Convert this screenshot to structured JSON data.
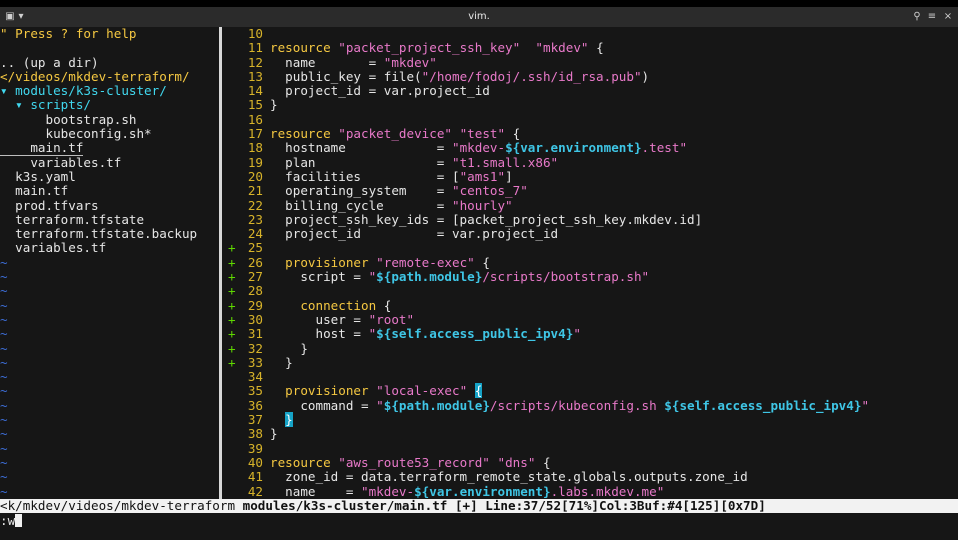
{
  "window": {
    "title": "vim.",
    "left_icons": [
      "terminal-icon",
      "dropdown-icon"
    ],
    "right_icons": [
      "search-icon",
      "menu-icon",
      "close-icon"
    ]
  },
  "tree": [
    {
      "text": "\" Press ? for help",
      "cls": "t-help"
    },
    {
      "text": "",
      "cls": "t-file"
    },
    {
      "text": ".. (up a dir)",
      "cls": "t-file"
    },
    {
      "text": "</videos/mkdev-terraform/",
      "cls": "t-root"
    },
    {
      "text": "▾ modules/k3s-cluster/",
      "cls": "t-dir"
    },
    {
      "text": "  ▾ scripts/",
      "cls": "t-dir"
    },
    {
      "text": "      bootstrap.sh",
      "cls": "t-file"
    },
    {
      "text": "      kubeconfig.sh*",
      "cls": "t-file"
    },
    {
      "text": "    main.tf",
      "cls": "t-file t-sel"
    },
    {
      "text": "    variables.tf",
      "cls": "t-file"
    },
    {
      "text": "  k3s.yaml",
      "cls": "t-file"
    },
    {
      "text": "  main.tf",
      "cls": "t-file"
    },
    {
      "text": "  prod.tfvars",
      "cls": "t-file"
    },
    {
      "text": "  terraform.tfstate",
      "cls": "t-file"
    },
    {
      "text": "  terraform.tfstate.backup",
      "cls": "t-file"
    },
    {
      "text": "  variables.tf",
      "cls": "t-file"
    }
  ],
  "tilde_rows": 17,
  "editor": [
    {
      "n": "10",
      "sign": "",
      "parts": []
    },
    {
      "n": "11",
      "sign": "",
      "parts": [
        [
          "k",
          "resource "
        ],
        [
          "s",
          "\"packet_project_ssh_key\""
        ],
        [
          "",
          "  "
        ],
        [
          "s",
          "\"mkdev\""
        ],
        [
          "",
          " {"
        ]
      ]
    },
    {
      "n": "12",
      "sign": "",
      "parts": [
        [
          "",
          "  name       = "
        ],
        [
          "s",
          "\"mkdev\""
        ]
      ]
    },
    {
      "n": "13",
      "sign": "",
      "parts": [
        [
          "",
          "  public_key = file("
        ],
        [
          "s",
          "\"/home/fodoj/.ssh/id_rsa.pub\""
        ],
        [
          "",
          ")"
        ]
      ]
    },
    {
      "n": "14",
      "sign": "",
      "parts": [
        [
          "",
          "  project_id = var.project_id"
        ]
      ]
    },
    {
      "n": "15",
      "sign": "",
      "parts": [
        [
          "",
          "}"
        ]
      ]
    },
    {
      "n": "16",
      "sign": "",
      "parts": []
    },
    {
      "n": "17",
      "sign": "",
      "parts": [
        [
          "k",
          "resource "
        ],
        [
          "s",
          "\"packet_device\""
        ],
        [
          "",
          " "
        ],
        [
          "s",
          "\"test\""
        ],
        [
          "",
          " {"
        ]
      ]
    },
    {
      "n": "18",
      "sign": "",
      "parts": [
        [
          "",
          "  hostname            = "
        ],
        [
          "s",
          "\"mkdev-"
        ],
        [
          "i",
          "${var.environment}"
        ],
        [
          "s",
          ".test\""
        ]
      ]
    },
    {
      "n": "19",
      "sign": "",
      "parts": [
        [
          "",
          "  plan                = "
        ],
        [
          "s",
          "\"t1.small.x86\""
        ]
      ]
    },
    {
      "n": "20",
      "sign": "",
      "parts": [
        [
          "",
          "  facilities          = ["
        ],
        [
          "s",
          "\"ams1\""
        ],
        [
          "",
          "]"
        ]
      ]
    },
    {
      "n": "21",
      "sign": "",
      "parts": [
        [
          "",
          "  operating_system    = "
        ],
        [
          "s",
          "\"centos_7\""
        ]
      ]
    },
    {
      "n": "22",
      "sign": "",
      "parts": [
        [
          "",
          "  billing_cycle       = "
        ],
        [
          "s",
          "\"hourly\""
        ]
      ]
    },
    {
      "n": "23",
      "sign": "",
      "parts": [
        [
          "",
          "  project_ssh_key_ids = [packet_project_ssh_key.mkdev.id]"
        ]
      ]
    },
    {
      "n": "24",
      "sign": "",
      "parts": [
        [
          "",
          "  project_id          = var.project_id"
        ]
      ]
    },
    {
      "n": "25",
      "sign": "+",
      "parts": []
    },
    {
      "n": "26",
      "sign": "+",
      "parts": [
        [
          "",
          "  "
        ],
        [
          "k",
          "provisioner "
        ],
        [
          "s",
          "\"remote-exec\""
        ],
        [
          "",
          " {"
        ]
      ]
    },
    {
      "n": "27",
      "sign": "+",
      "parts": [
        [
          "",
          "    script = "
        ],
        [
          "s",
          "\""
        ],
        [
          "i",
          "${path.module}"
        ],
        [
          "s",
          "/scripts/bootstrap.sh\""
        ]
      ]
    },
    {
      "n": "28",
      "sign": "+",
      "parts": []
    },
    {
      "n": "29",
      "sign": "+",
      "parts": [
        [
          "",
          "    "
        ],
        [
          "k",
          "connection "
        ],
        [
          "",
          "{"
        ]
      ]
    },
    {
      "n": "30",
      "sign": "+",
      "parts": [
        [
          "",
          "      user = "
        ],
        [
          "s",
          "\"root\""
        ]
      ]
    },
    {
      "n": "31",
      "sign": "+",
      "parts": [
        [
          "",
          "      host = "
        ],
        [
          "s",
          "\""
        ],
        [
          "i",
          "${self.access_public_ipv4}"
        ],
        [
          "s",
          "\""
        ]
      ]
    },
    {
      "n": "32",
      "sign": "+",
      "parts": [
        [
          "",
          "    }"
        ]
      ]
    },
    {
      "n": "33",
      "sign": "+",
      "parts": [
        [
          "",
          "  }"
        ]
      ]
    },
    {
      "n": "34",
      "sign": "",
      "parts": []
    },
    {
      "n": "35",
      "sign": "",
      "parts": [
        [
          "",
          "  "
        ],
        [
          "k",
          "provisioner "
        ],
        [
          "s",
          "\"local-exec\""
        ],
        [
          "",
          " "
        ],
        [
          "m",
          "{"
        ]
      ]
    },
    {
      "n": "36",
      "sign": "",
      "parts": [
        [
          "",
          "    command = "
        ],
        [
          "s",
          "\""
        ],
        [
          "i",
          "${path.module}"
        ],
        [
          "s",
          "/scripts/kubeconfig.sh "
        ],
        [
          "i",
          "${self.access_public_ipv4}"
        ],
        [
          "s",
          "\""
        ]
      ]
    },
    {
      "n": "37",
      "sign": "",
      "parts": [
        [
          "",
          "  "
        ],
        [
          "m",
          "}"
        ]
      ]
    },
    {
      "n": "38",
      "sign": "",
      "parts": [
        [
          "",
          "}"
        ]
      ]
    },
    {
      "n": "39",
      "sign": "",
      "parts": []
    },
    {
      "n": "40",
      "sign": "",
      "parts": [
        [
          "k",
          "resource "
        ],
        [
          "s",
          "\"aws_route53_record\""
        ],
        [
          "",
          " "
        ],
        [
          "s",
          "\"dns\""
        ],
        [
          "",
          " {"
        ]
      ]
    },
    {
      "n": "41",
      "sign": "",
      "parts": [
        [
          "",
          "  zone_id = data.terraform_remote_state.globals.outputs.zone_id"
        ]
      ]
    },
    {
      "n": "42",
      "sign": "",
      "parts": [
        [
          "",
          "  name    = "
        ],
        [
          "s",
          "\"mkdev-"
        ],
        [
          "i",
          "${var.environment}"
        ],
        [
          "s",
          ".labs.mkdev.me\""
        ]
      ]
    }
  ],
  "status": {
    "left": "<k/mkdev/videos/mkdev-terraform ",
    "file": "modules/k3s-cluster/main.tf",
    "rest": " [+] Line:37/52[71%]Col:3Buf:#4[125][0x7D]"
  },
  "cmdline": ":w"
}
